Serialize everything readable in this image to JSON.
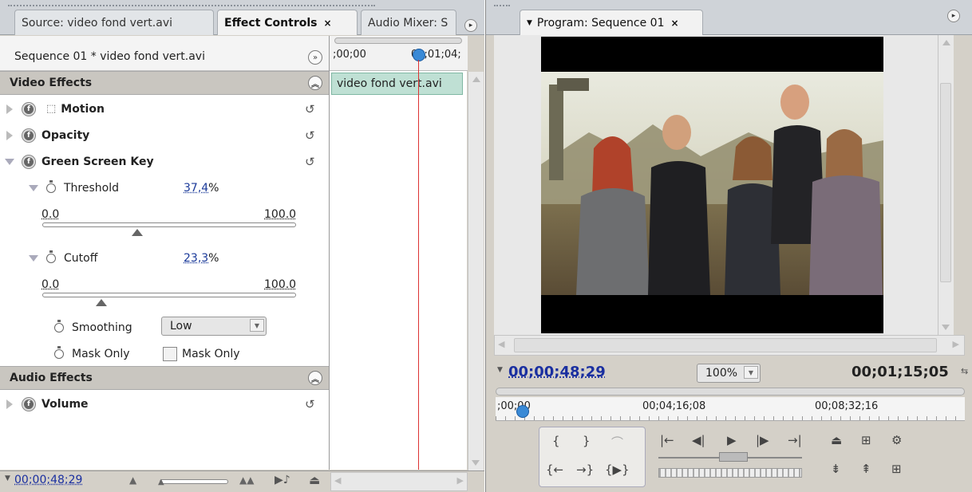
{
  "source_panel": {
    "tabs": [
      {
        "label": "Source: video fond vert.avi"
      },
      {
        "label": "Effect Controls",
        "close": "×"
      },
      {
        "label": "Audio Mixer: S"
      }
    ],
    "sequence_label": "Sequence 01 * video fond vert.avi",
    "timeline": {
      "start_tc": ";00;00",
      "end_tc": "00;01;04;",
      "clip_name": "video fond vert.avi"
    },
    "video_effects_header": "Video Effects",
    "effects": [
      {
        "name": "Motion"
      },
      {
        "name": "Opacity"
      },
      {
        "name": "Green Screen Key"
      }
    ],
    "threshold": {
      "label": "Threshold",
      "value": "37,4",
      "unit": "%",
      "min": "0.0",
      "max": "100.0",
      "level": 0.374
    },
    "cutoff": {
      "label": "Cutoff",
      "value": "23,3",
      "unit": "%",
      "min": "0.0",
      "max": "100.0",
      "level": 0.233
    },
    "smoothing": {
      "label": "Smoothing",
      "value": "Low"
    },
    "mask_only": {
      "label": "Mask Only",
      "checkbox_label": "Mask Only"
    },
    "audio_effects_header": "Audio Effects",
    "audio_effect": "Volume",
    "footer_timecode": "00;00;48;29"
  },
  "program_panel": {
    "tab_label": "Program: Sequence 01",
    "tab_close": "×",
    "current_tc": "00;00;48;29",
    "zoom": "100%",
    "duration_tc": "00;01;15;05",
    "ruler": {
      "t0": ";00;00",
      "t1": "00;04;16;08",
      "t2": "00;08;32;16"
    }
  },
  "colors": {
    "timecode": "#1a2fa0",
    "playhead": "#d33333",
    "clip": "#bfe0d4"
  }
}
